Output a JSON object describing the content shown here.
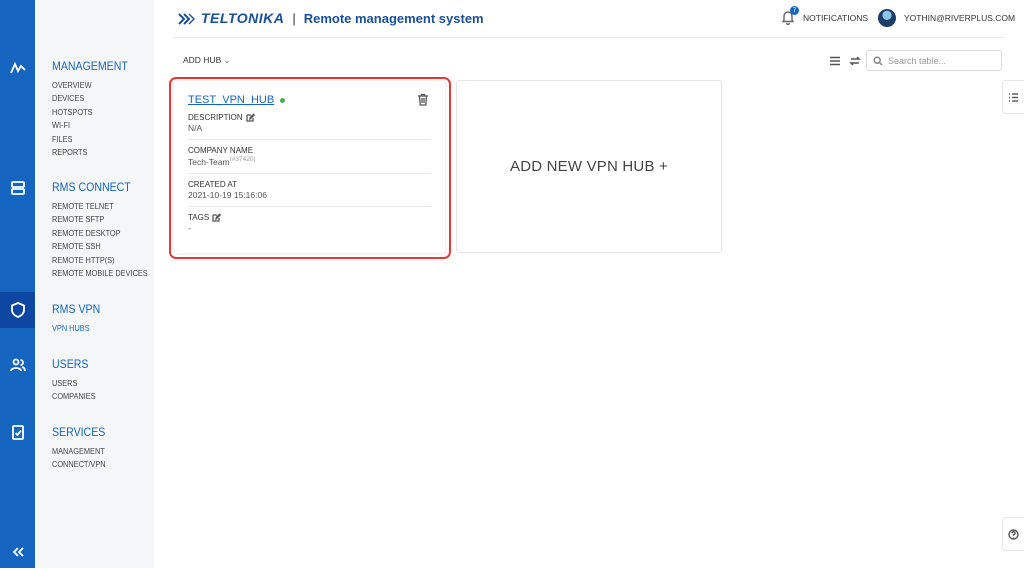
{
  "header": {
    "logo": "TELTONIKA",
    "separator": "|",
    "subtitle": "Remote management system",
    "notifications_label": "NOTIFICATIONS",
    "notifications_count": "7",
    "user_label": "YOTHIN@RIVERPLUS.COM"
  },
  "rail": {
    "icons": [
      "activity-icon",
      "server-icon",
      "shield-icon",
      "users-icon",
      "clipboard-check-icon",
      "collapse-icon"
    ],
    "accent": "#1565c0"
  },
  "nav": {
    "management": {
      "heading": "MANAGEMENT",
      "items": [
        "OVERVIEW",
        "DEVICES",
        "HOTSPOTS",
        "WI-FI",
        "FILES",
        "REPORTS"
      ]
    },
    "rms_connect": {
      "heading": "RMS CONNECT",
      "items": [
        "REMOTE TELNET",
        "REMOTE SFTP",
        "REMOTE DESKTOP",
        "REMOTE SSH",
        "REMOTE HTTP(S)",
        "REMOTE MOBILE DEVICES"
      ]
    },
    "rms_vpn": {
      "heading": "RMS VPN",
      "items": [
        "VPN HUBS"
      ]
    },
    "users": {
      "heading": "USERS",
      "items": [
        "USERS",
        "COMPANIES"
      ]
    },
    "services": {
      "heading": "SERVICES",
      "items": [
        "MANAGEMENT",
        "CONNECT/VPN"
      ]
    }
  },
  "toolbar": {
    "add_hub": "ADD HUB",
    "search_placeholder": "Search table..."
  },
  "hub_card": {
    "title": "TEST_VPN_HUB",
    "status_color": "#4caf50",
    "description_label": "DESCRIPTION",
    "description_value": "N/A",
    "company_label": "COMPANY NAME",
    "company_value": "Tech-Team",
    "company_id": "(#37420)",
    "created_label": "CREATED AT",
    "created_value": "2021-10-19 15:16:06",
    "tags_label": "TAGS",
    "tags_value": "-"
  },
  "add_card": {
    "label": "ADD NEW VPN HUB +"
  },
  "highlight_color": "#e53935"
}
